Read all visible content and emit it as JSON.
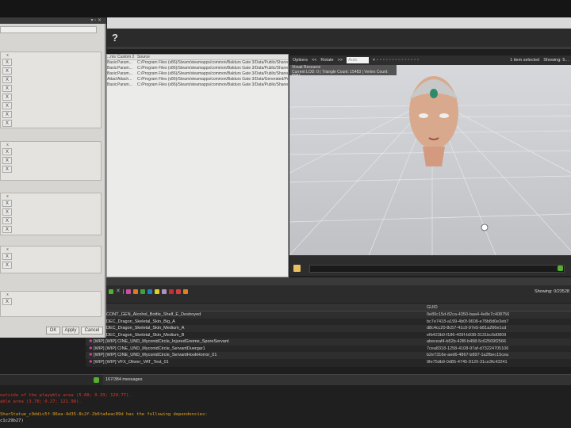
{
  "dialog": {
    "x_header": "x",
    "x_label": "X",
    "section_counts": [
      8,
      3,
      4,
      2,
      1
    ],
    "buttons": {
      "ok": "OK",
      "apply": "Apply",
      "cancel": "Cancel"
    }
  },
  "menubar": {
    "help": "?"
  },
  "resource_table": {
    "headers": [
      "...ms 1",
      "Custom 2",
      "Source"
    ],
    "rows": [
      [
        "Basic: F...",
        "Param...",
        "C:/Program Files (x86)/Steam/steamapps/common/Baldurs Gate 3/Data/Public/Shared/Assets"
      ],
      [
        "Basic: F...",
        "Param...",
        "C:/Program Files (x86)/Steam/steamapps/common/Baldurs Gate 3/Data/Public/Shared/Assets"
      ],
      [
        "Basic: F...",
        "Param...",
        "C:/Program Files (x86)/Steam/steamapps/common/Baldurs Gate 3/Data/Public/Shared/Assets"
      ],
      [
        "Attach...",
        "Attach...",
        "C:/Program Files (x86)/Steam/steamapps/common/Baldurs Gate 3/Data/Generated/Public/"
      ],
      [
        "Basic: F...",
        "Param...",
        "C:/Program Files (x86)/Steam/steamapps/common/Baldurs Gate 3/Data/Public/Shared/Assets"
      ]
    ]
  },
  "viewport": {
    "options": "Options",
    "prev": "<<",
    "rotate": "Rotate",
    "next": ">>",
    "mode_placeholder": "Auto",
    "selection": "1 item selected",
    "showing": "Showing: 5...",
    "info_title": "Visual Resource",
    "info_lod": "Current LOD: 0",
    "info_triangles": "Triangle Count: 15483",
    "info_vertices": "Vertex Count: 8081"
  },
  "list": {
    "showing": "Showing: 0/23528",
    "guid_header": "GUID",
    "rows": [
      {
        "name": "CONT_GEN_Alcohol_Bottle_Shelf_E_Destroyed",
        "guid": "0e89c15d-82ca-4350-baa4-4e8e7c408756",
        "icon": false
      },
      {
        "name": "DEC_Dragon_Skeletal_Skin_Big_A",
        "guid": "bc7e7418-a199-4b0f-9608-e78b8d0e3eb7",
        "icon": false
      },
      {
        "name": "DEC_Dragon_Skeletal_Skin_Medium_A",
        "guid": "d8c4cc20-8c57-41c0-97e5-b81a266e1cd",
        "icon": false
      },
      {
        "name": "DEC_Dragon_Skeletal_Skin_Medium_B",
        "guid": "efb423b0-f186-409f-b938-3131bc6d0809",
        "icon": false
      },
      {
        "name": "[WIP] [WIP] CINE_UND_MyconidCircle_InjuredGnome_SporeServant",
        "guid": "abeceaf4-b52b-42f8-b498-5c62569f2566",
        "icon": true
      },
      {
        "name": "[WIP] [WIP] CINE_UND_MyconidCircle_ServantDuergar1",
        "guid": "7cea8318-1258-4108-97af-d73224705106",
        "icon": true
      },
      {
        "name": "[WIP] [WIP] CINE_UND_MyconidCircle_ServantHookHorror_01",
        "guid": "b2e7316e-aed6-4867-b897-1a2fbec15cea",
        "icon": true
      },
      {
        "name": "[WIP] [WIP] VFX_Olivier_VAT_Test_01",
        "guid": "9fe75db9-0d85-4745-9120-31ce3fc43241",
        "icon": true
      }
    ]
  },
  "status": {
    "messages": "167/384 messages"
  },
  "log": [
    {
      "text": "outside of the playable area (5.68; 0.33; 120.77).",
      "level": "error"
    },
    {
      "text": "able area (3.78; 0.27; 121.98).",
      "level": "error"
    },
    {
      "text": "",
      "level": "none"
    },
    {
      "text": "SharStatue_c9ddic5f-96ea-4d35-8c2f-2b6ta4eac09d has the following dependencies:",
      "level": "warning"
    },
    {
      "text": "c1c29b27)",
      "level": "info"
    }
  ],
  "colors": {
    "error": "#d9392c",
    "warning": "#e0a020",
    "accent": "#56b030"
  }
}
